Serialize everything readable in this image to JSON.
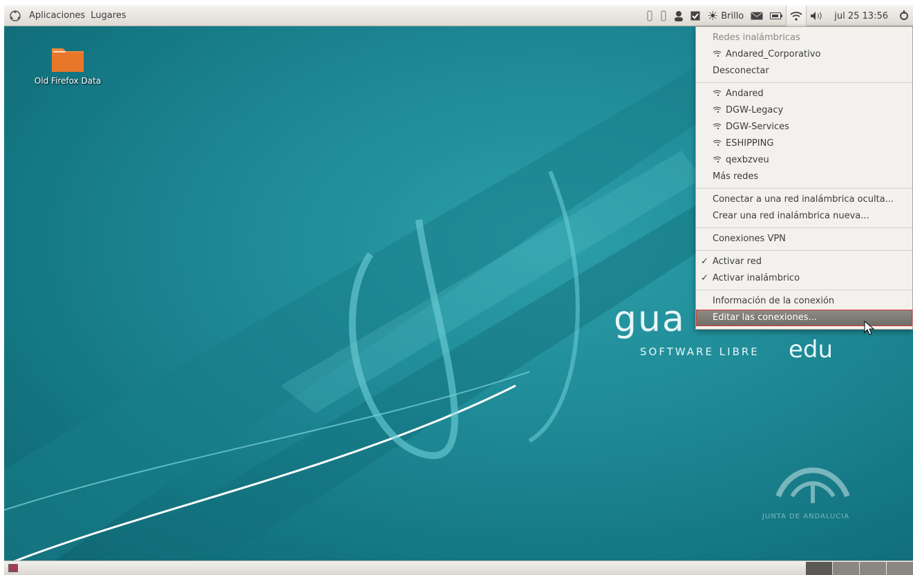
{
  "top_panel": {
    "menu_apps": "Aplicaciones",
    "menu_places": "Lugares",
    "brightness_label": "Brillo",
    "clock": "jul 25 13:56"
  },
  "desktop": {
    "icon_label": "Old Firefox Data",
    "brand_main": "gua",
    "brand_sub": "SOFTWARE LIBRE",
    "brand_edu": "edu",
    "junta_title": "JUNTA DE ANDALUCIA"
  },
  "network_menu": {
    "header": "Redes inalámbricas",
    "connected": "Andared_Corporativo",
    "disconnect": "Desconectar",
    "networks": [
      "Andared",
      "DGW-Legacy",
      "DGW-Services",
      "ESHIPPING",
      "qexbzveu"
    ],
    "more": "Más redes",
    "hidden": "Conectar a una red inalámbrica oculta...",
    "create": "Crear una red inalámbrica nueva...",
    "vpn": "Conexiones VPN",
    "enable_net": "Activar red",
    "enable_wifi": "Activar inalámbrico",
    "info": "Información de la conexión",
    "edit": "Editar las conexiones..."
  },
  "colors": {
    "desktop_teal": "#1e8a96",
    "menu_bg": "#f3f1ed",
    "hover": "#7d7a74",
    "highlight_border": "#dd3333"
  }
}
